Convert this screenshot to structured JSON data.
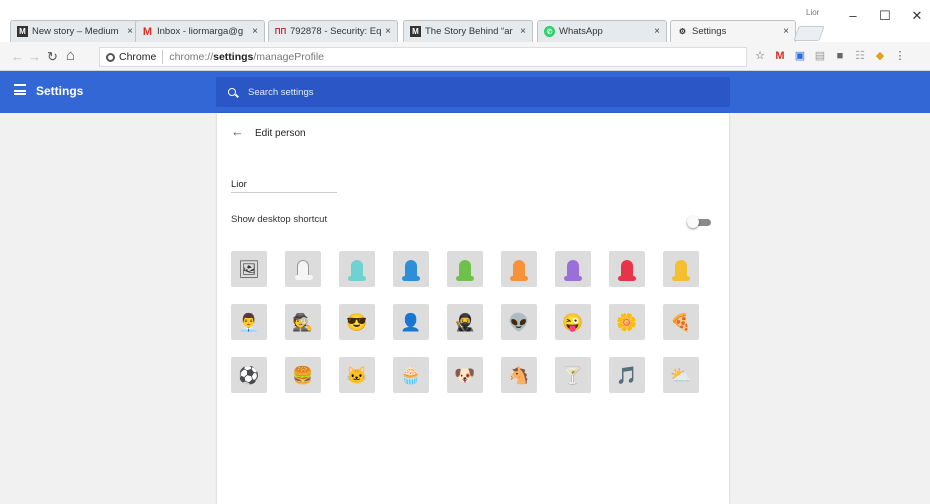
{
  "browser": {
    "tabs": [
      {
        "title": "New story – Medium",
        "favicon": "medium-icon",
        "icon_text": "M",
        "close": "×"
      },
      {
        "title": "Inbox - liormarga@g",
        "favicon": "gmail-icon",
        "icon_text": "M",
        "close": "×"
      },
      {
        "title": "792878 - Security: Eq",
        "favicon": "tracker-icon",
        "icon_text": "ΠΠ",
        "close": "×"
      },
      {
        "title": "The Story Behind “ar",
        "favicon": "medium-icon",
        "icon_text": "M",
        "close": "×"
      },
      {
        "title": "WhatsApp",
        "favicon": "whatsapp-icon",
        "icon_text": "✆",
        "close": "×"
      },
      {
        "title": "Settings",
        "favicon": "gear-icon",
        "icon_text": "⚙",
        "close": "×"
      }
    ],
    "profile_label": "Lior",
    "window_controls": {
      "minimize": "–",
      "maximize": "☐",
      "close": "✕"
    },
    "nav": {
      "back": "←",
      "forward": "→",
      "reload": "↻",
      "home": "⌂"
    },
    "omnibox": {
      "site_label": "Chrome",
      "url_prefix": "chrome://",
      "url_bold": "settings",
      "url_suffix": "/manageProfile"
    },
    "toolbar_icons": [
      {
        "name": "star-icon",
        "glyph": "☆",
        "color": "#555555"
      },
      {
        "name": "gmail-extension-icon",
        "glyph": "M",
        "color": "#d93025"
      },
      {
        "name": "download-extension-icon",
        "glyph": "▣",
        "color": "#2d6cdf"
      },
      {
        "name": "extension-icon",
        "glyph": "▤",
        "color": "#999999"
      },
      {
        "name": "extension-icon",
        "glyph": "■",
        "color": "#666666"
      },
      {
        "name": "extension-icon",
        "glyph": "☷",
        "color": "#aaaaaa"
      },
      {
        "name": "extension-icon",
        "glyph": "◆",
        "color": "#e0a020"
      },
      {
        "name": "chrome-menu-icon",
        "glyph": "⋮",
        "color": "#555555"
      }
    ]
  },
  "header": {
    "title": "Settings",
    "search_placeholder": "Search settings"
  },
  "card": {
    "back_glyph": "←",
    "title": "Edit person",
    "name_value": "Lior",
    "shortcut_label": "Show desktop shortcut",
    "shortcut_enabled": false
  },
  "avatars": [
    {
      "name": "avatar-photo",
      "glyph": "🖼"
    },
    {
      "name": "avatar-generic-white",
      "head_color": "#f5f5f5"
    },
    {
      "name": "avatar-generic-teal",
      "head_color": "#6ed2d0"
    },
    {
      "name": "avatar-generic-blue",
      "head_color": "#2e8fd8"
    },
    {
      "name": "avatar-generic-green",
      "head_color": "#6ec14a"
    },
    {
      "name": "avatar-generic-orange",
      "head_color": "#f5923a"
    },
    {
      "name": "avatar-generic-purple",
      "head_color": "#9a6fd8"
    },
    {
      "name": "avatar-generic-red",
      "head_color": "#e8344a"
    },
    {
      "name": "avatar-generic-yellow",
      "head_color": "#f4c030"
    },
    {
      "name": "avatar-businessman",
      "glyph": "👨‍💼"
    },
    {
      "name": "avatar-ninja-glasses",
      "glyph": "🕵"
    },
    {
      "name": "avatar-sunglasses",
      "glyph": "😎"
    },
    {
      "name": "avatar-person-dark",
      "glyph": "👤"
    },
    {
      "name": "avatar-ninja",
      "glyph": "🥷"
    },
    {
      "name": "avatar-alien",
      "glyph": "👽"
    },
    {
      "name": "avatar-smiley",
      "glyph": "😜"
    },
    {
      "name": "avatar-flower",
      "glyph": "🌼"
    },
    {
      "name": "avatar-pizza",
      "glyph": "🍕"
    },
    {
      "name": "avatar-soccer",
      "glyph": "⚽"
    },
    {
      "name": "avatar-burger",
      "glyph": "🍔"
    },
    {
      "name": "avatar-cat",
      "glyph": "🐱"
    },
    {
      "name": "avatar-cupcake",
      "glyph": "🧁"
    },
    {
      "name": "avatar-dog",
      "glyph": "🐶"
    },
    {
      "name": "avatar-horse",
      "glyph": "🐴"
    },
    {
      "name": "avatar-cocktail",
      "glyph": "🍸"
    },
    {
      "name": "avatar-music-note",
      "glyph": "🎵"
    },
    {
      "name": "avatar-sun-cloud",
      "glyph": "⛅"
    }
  ],
  "colors": {
    "header_blue": "#3367d6",
    "search_blue": "#2a56c6",
    "page_bg": "#f1f1f1",
    "tile_bg": "#dcdcdc"
  }
}
